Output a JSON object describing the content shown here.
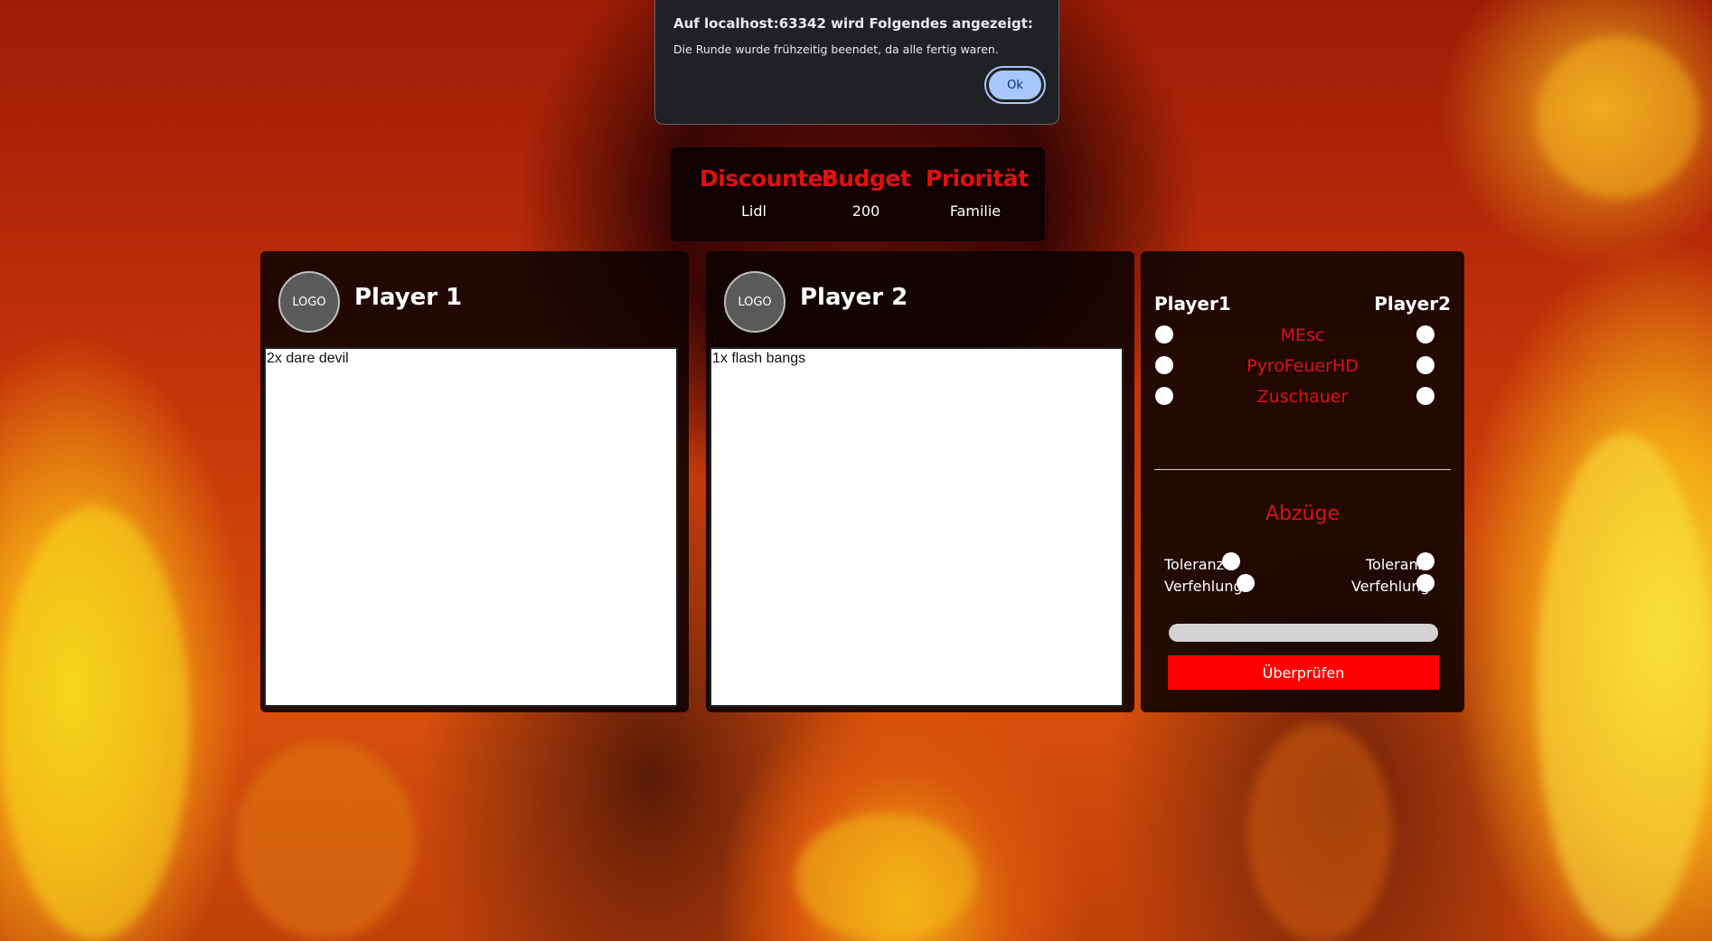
{
  "alert": {
    "title": "Auf localhost:63342 wird Folgendes angezeigt:",
    "message": "Die Runde wurde frühzeitig beendet, da alle fertig waren.",
    "ok_label": "Ok"
  },
  "info": {
    "discounter_label": "Discounter",
    "discounter_value": "Lidl",
    "budget_label": "Budget",
    "budget_value": "200",
    "priority_label": "Priorität",
    "priority_value": "Familie"
  },
  "player1": {
    "logo": "LOGO",
    "name": "Player 1",
    "items": "2x dare devil"
  },
  "player2": {
    "logo": "LOGO",
    "name": "Player 2",
    "items": "1x flash bangs"
  },
  "voting": {
    "player1_header": "Player1",
    "player2_header": "Player2",
    "voters": [
      "MEsc",
      "PyroFeuerHD",
      "Zuschauer"
    ]
  },
  "deductions": {
    "title": "Abzüge",
    "tolerance_label": "Toleranz",
    "mistake_label": "Verfehlung"
  },
  "check_button": "Überprüfen",
  "colors": {
    "accent_red": "#e01010",
    "button_red": "#ff0000",
    "alert_button": "#a8c7fa"
  }
}
